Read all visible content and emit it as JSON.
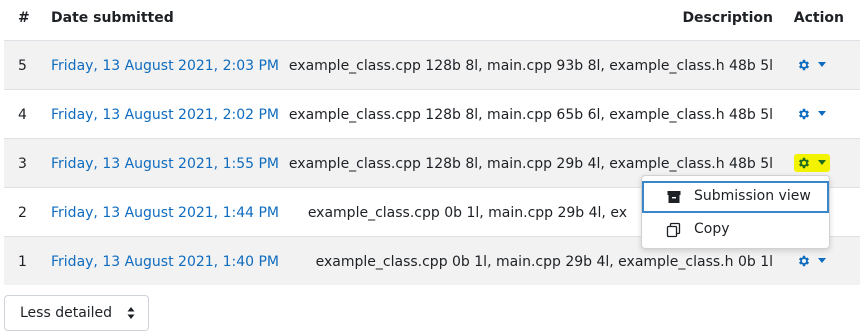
{
  "table": {
    "headers": {
      "num": "#",
      "date": "Date submitted",
      "description": "Description",
      "action": "Action"
    },
    "rows": [
      {
        "num": "5",
        "date": "Friday, 13 August 2021, 2:03 PM",
        "description": "example_class.cpp 128b 8l, main.cpp 93b 8l, example_class.h 48b 5l"
      },
      {
        "num": "4",
        "date": "Friday, 13 August 2021, 2:02 PM",
        "description": "example_class.cpp 128b 8l, main.cpp 65b 6l, example_class.h 48b 5l"
      },
      {
        "num": "3",
        "date": "Friday, 13 August 2021, 1:55 PM",
        "description": "example_class.cpp 128b 8l, main.cpp 29b 4l, example_class.h 48b 5l"
      },
      {
        "num": "2",
        "date": "Friday, 13 August 2021, 1:44 PM",
        "description": "example_class.cpp 0b 1l, main.cpp 29b 4l, ex"
      },
      {
        "num": "1",
        "date": "Friday, 13 August 2021, 1:40 PM",
        "description": "example_class.cpp 0b 1l, main.cpp 29b 4l, example_class.h 0b 1l"
      }
    ]
  },
  "action_menu": {
    "items": [
      {
        "label": "Submission view",
        "icon": "archive-box-icon"
      },
      {
        "label": "Copy",
        "icon": "copy-icon"
      }
    ]
  },
  "view_select": {
    "selected": "Less detailed"
  },
  "colors": {
    "link": "#0f6cbf",
    "highlight": "#f3f300",
    "focus": "#3a86c8"
  }
}
